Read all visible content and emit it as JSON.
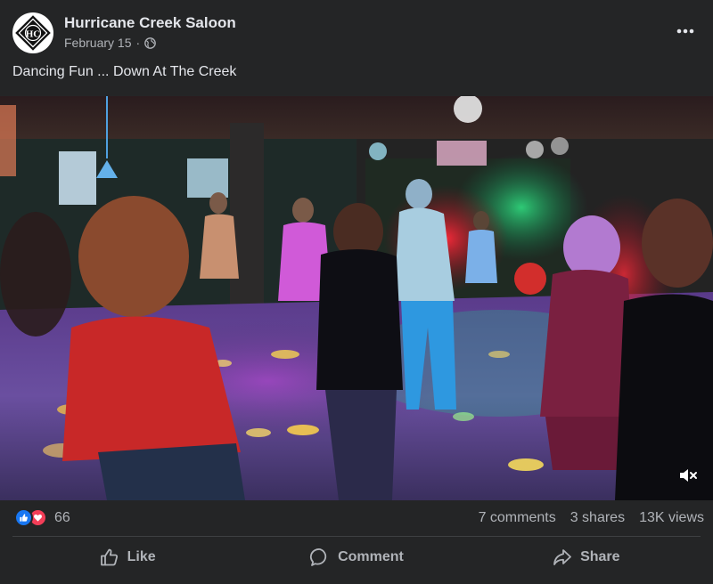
{
  "post": {
    "page_name": "Hurricane Creek Saloon",
    "date": "February 15",
    "separator": "·",
    "caption": "Dancing Fun ... Down At The Creek",
    "avatar_monogram": "HC"
  },
  "stats": {
    "reaction_count": "66",
    "comments": "7 comments",
    "shares": "3 shares",
    "views": "13K views"
  },
  "actions": {
    "like": "Like",
    "comment": "Comment",
    "share": "Share"
  },
  "icons": {
    "avatar": "hurricane-creek-logo",
    "privacy": "globe-icon",
    "more": "ellipsis-icon",
    "mute": "speaker-muted-icon",
    "reaction_like": "thumbs-up-icon",
    "reaction_love": "heart-icon"
  },
  "colors": {
    "background": "#242526",
    "text_primary": "#e4e6eb",
    "text_secondary": "#b0b3b8",
    "like_blue": "#1877f2",
    "love_red": "#f33e58"
  }
}
